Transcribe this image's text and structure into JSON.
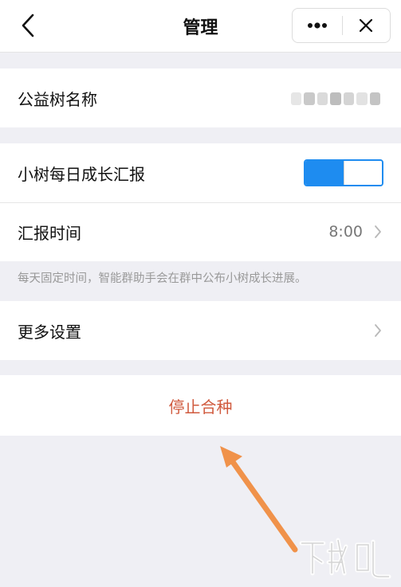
{
  "header": {
    "title": "管理",
    "back_icon": "chevron-left-icon",
    "more_icon": "more-dots-icon",
    "close_icon": "close-icon"
  },
  "name_row": {
    "label": "公益树名称"
  },
  "report_row": {
    "label": "小树每日成长汇报",
    "toggle_on": true,
    "toggle_level": 0.5,
    "accent": "#1e8cf0"
  },
  "time_row": {
    "label": "汇报时间",
    "value": "8:00"
  },
  "note": "每天固定时间，智能群助手会在群中公布小树成长进展。",
  "more_row": {
    "label": "更多设置"
  },
  "stop": {
    "label": "停止合种",
    "color": "#d05a3e"
  },
  "annotation": {
    "icon": "arrow-icon",
    "color": "#f0924a"
  },
  "watermark": {
    "icon": "watermark-logo-icon",
    "text": "下载吧"
  }
}
